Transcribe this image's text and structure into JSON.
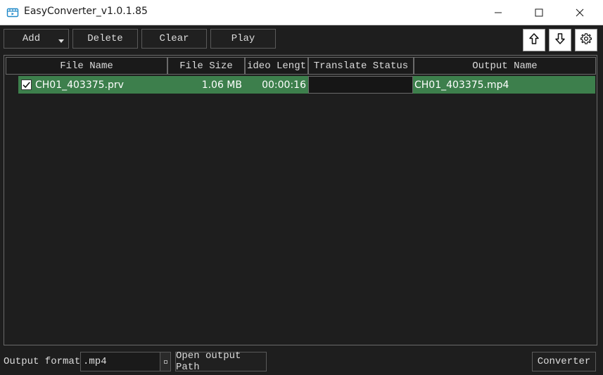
{
  "window": {
    "title": "EasyConverter_v1.0.1.85",
    "app_icon": "film-icon",
    "controls": [
      "minimize-icon",
      "maximize-icon",
      "close-icon"
    ]
  },
  "toolbar": {
    "add_label": "Add",
    "delete_label": "Delete",
    "clear_label": "Clear",
    "play_label": "Play",
    "icons": [
      "arrow-up-icon",
      "arrow-down-icon",
      "gear-icon"
    ]
  },
  "table": {
    "headers": [
      "File Name",
      "File Size",
      "ideo Lengt",
      "Translate Status",
      "Output Name"
    ],
    "rows": [
      {
        "checked": true,
        "file_name": "CH01_403375.prv",
        "file_size": "1.06 MB",
        "video_length": "00:00:16",
        "translate_status": "",
        "output_name": "CH01_403375.mp4"
      }
    ]
  },
  "footer": {
    "output_format_label": "Output format",
    "output_format_value": ".mp4",
    "open_output_path_label": "Open output Path",
    "converter_label": "Converter"
  },
  "colors": {
    "background": "#1e1e1e",
    "selected_row": "#3d7f4c",
    "border": "#6a6a6a",
    "text": "#dcdcdc"
  }
}
